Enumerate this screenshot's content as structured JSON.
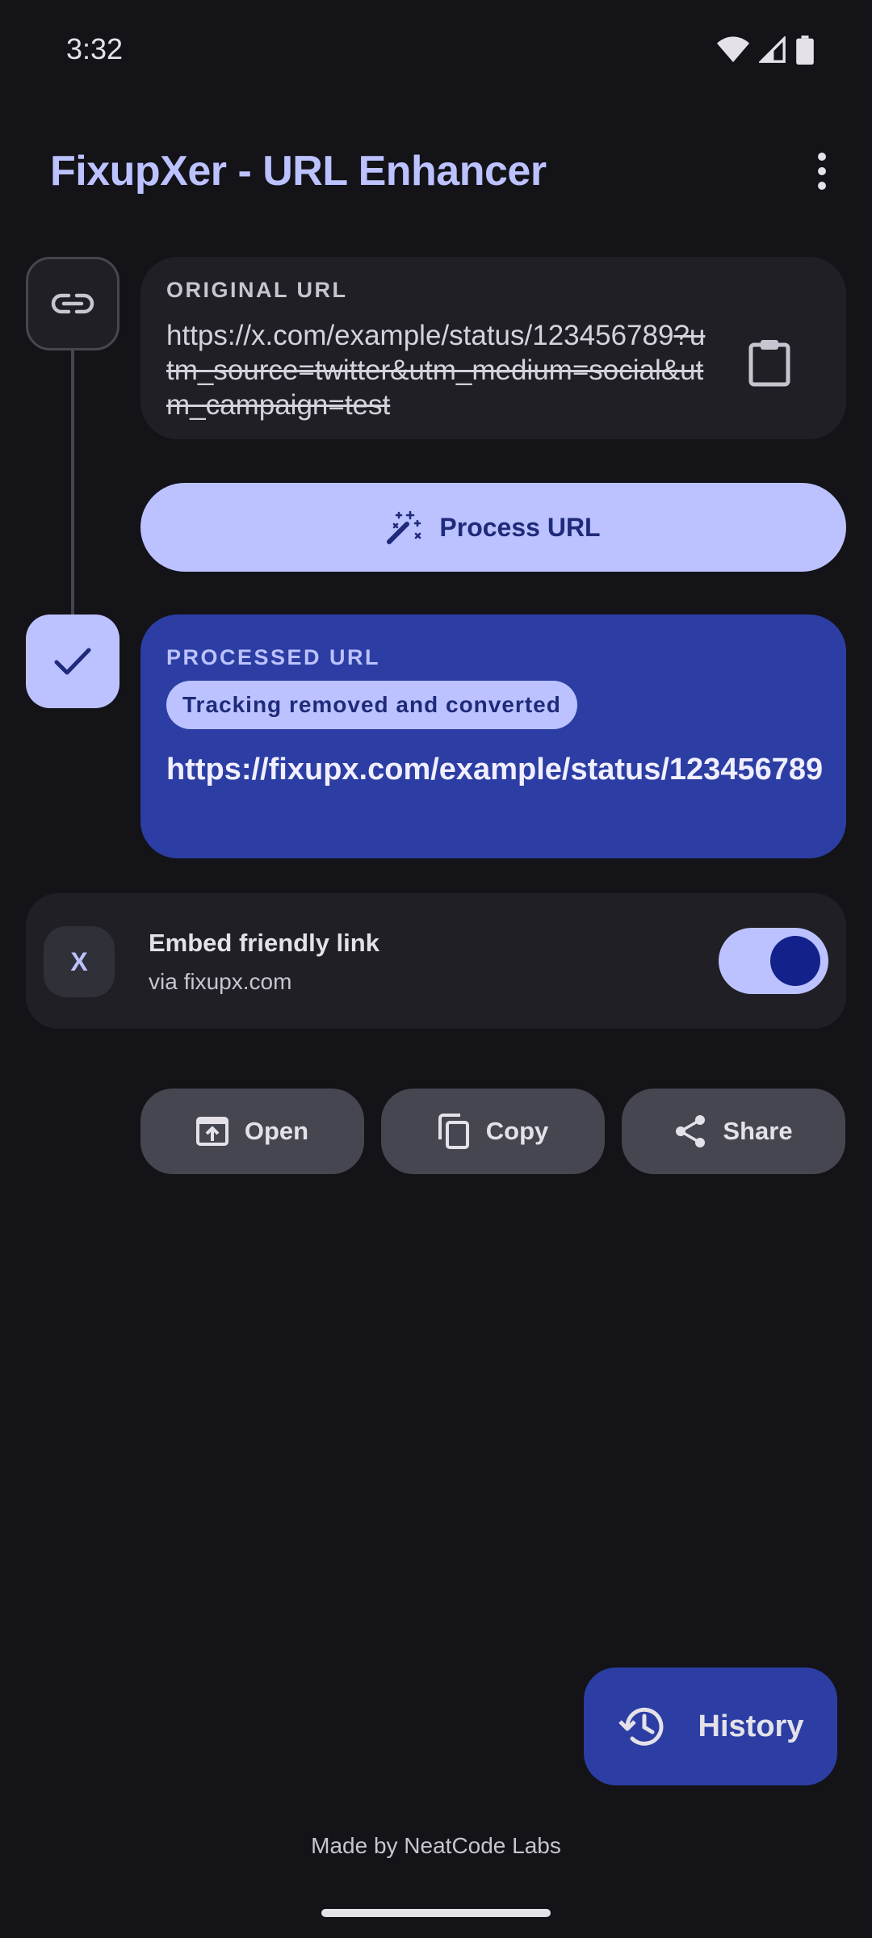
{
  "status_bar": {
    "time": "3:32",
    "icons": [
      "wifi-icon",
      "signal-icon",
      "battery-icon"
    ]
  },
  "app": {
    "title": "FixupXer - URL Enhancer",
    "menu_icon": "more-vert-icon"
  },
  "original": {
    "label": "ORIGINAL URL",
    "url_kept": "https://x.com/example/status/123456789",
    "url_removed": "?utm_source=twitter&utm_medium=social&utm_campaign=test",
    "paste_icon": "clipboard-icon"
  },
  "process_button": {
    "label": "Process URL",
    "icon": "magic-wand-icon"
  },
  "processed": {
    "label": "PROCESSED URL",
    "badge": "Tracking removed and converted",
    "url": "https://fixupx.com/example/status/123456789"
  },
  "embed": {
    "avatar_letter": "X",
    "title": "Embed friendly link",
    "subtitle": "via fixupx.com",
    "enabled": true
  },
  "actions": [
    {
      "label": "Open",
      "icon": "open-in-app-icon"
    },
    {
      "label": "Copy",
      "icon": "copy-icon"
    },
    {
      "label": "Share",
      "icon": "share-icon"
    }
  ],
  "history_fab": {
    "label": "History",
    "icon": "history-icon"
  },
  "footer": "Made by NeatCode Labs",
  "colors": {
    "background": "#131318",
    "surface": "#1f1f25",
    "primary": "#bcc2ff",
    "primary_container": "#2c3ea3",
    "on_primary": "#1f2a7a",
    "secondary_container": "#45464f"
  }
}
